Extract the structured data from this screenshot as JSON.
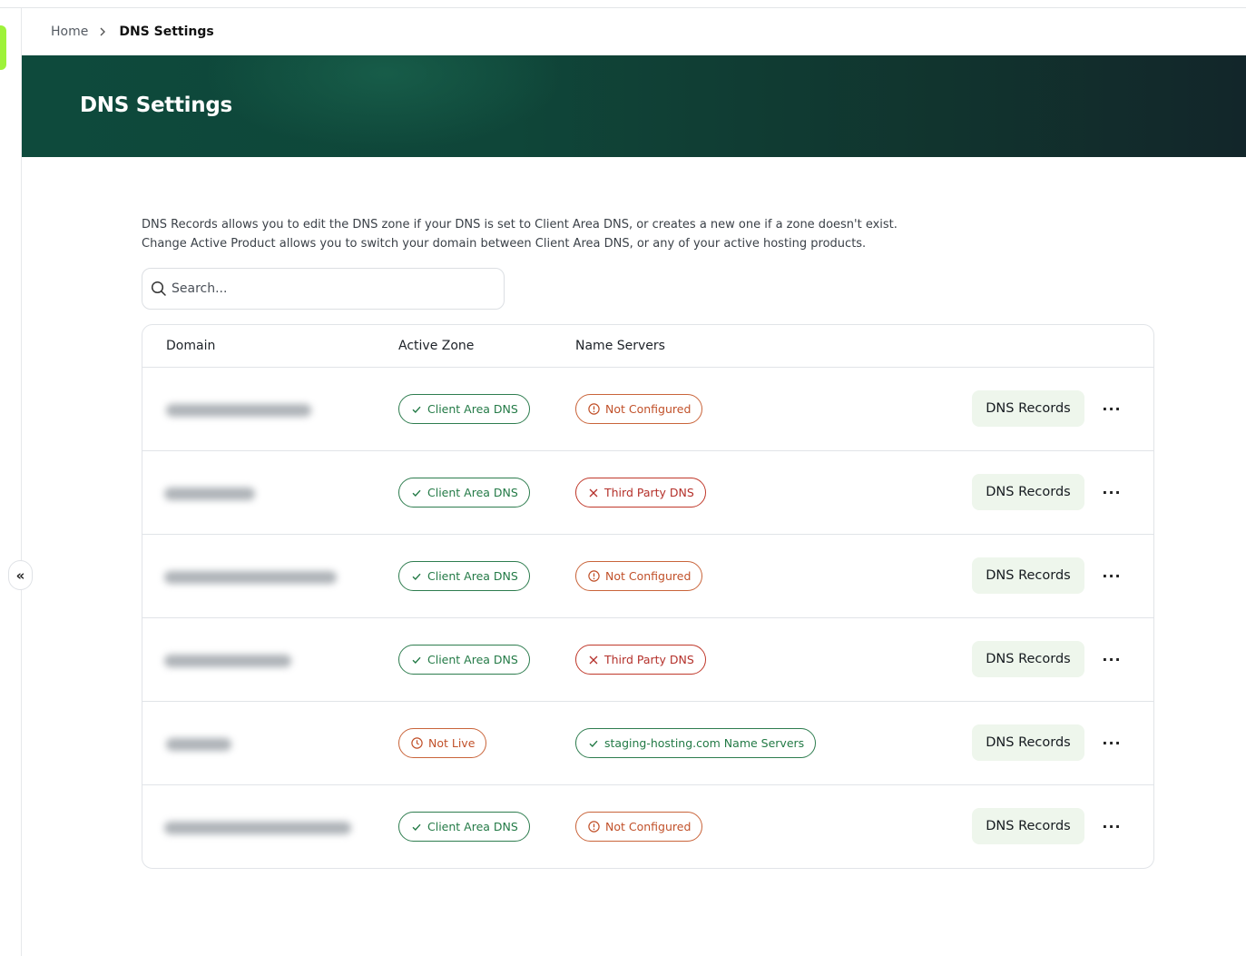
{
  "breadcrumb": {
    "home": "Home",
    "current": "DNS Settings"
  },
  "hero": {
    "title": "DNS Settings"
  },
  "description": {
    "line1": "DNS Records allows you to edit the DNS zone if your DNS is set to Client Area DNS, or creates a new one if a zone doesn't exist.",
    "line2": "Change Active Product allows you to switch your domain between Client Area DNS, or any of your active hosting products."
  },
  "search": {
    "placeholder": "Search..."
  },
  "table": {
    "columns": {
      "domain": "Domain",
      "active_zone": "Active Zone",
      "name_servers": "Name Servers"
    },
    "rows": [
      {
        "domain": "",
        "zone": {
          "label": "Client Area DNS",
          "status": "success"
        },
        "ns": {
          "label": "Not Configured",
          "status": "warning"
        },
        "action": "DNS Records",
        "more": "···"
      },
      {
        "domain": "",
        "zone": {
          "label": "Client Area DNS",
          "status": "success"
        },
        "ns": {
          "label": "Third Party DNS",
          "status": "error"
        },
        "action": "DNS Records",
        "more": "···"
      },
      {
        "domain": "",
        "zone": {
          "label": "Client Area DNS",
          "status": "success"
        },
        "ns": {
          "label": "Not Configured",
          "status": "warning"
        },
        "action": "DNS Records",
        "more": "···"
      },
      {
        "domain": "",
        "zone": {
          "label": "Client Area DNS",
          "status": "success"
        },
        "ns": {
          "label": "Third Party DNS",
          "status": "error"
        },
        "action": "DNS Records",
        "more": "···"
      },
      {
        "domain": "",
        "zone": {
          "label": "Not Live",
          "status": "pending"
        },
        "ns": {
          "label": "staging-hosting.com Name Servers",
          "status": "success"
        },
        "action": "DNS Records",
        "more": "···"
      },
      {
        "domain": "",
        "zone": {
          "label": "Client Area DNS",
          "status": "success"
        },
        "ns": {
          "label": "Not Configured",
          "status": "warning"
        },
        "action": "DNS Records",
        "more": "···"
      }
    ]
  },
  "sidebar": {
    "collapse_label": "«"
  },
  "colors": {
    "accent": "#9ef23a",
    "hero_start": "#0e4a3c",
    "hero_end": "#12262a",
    "success": "#237a46",
    "warning": "#c1512a",
    "error": "#b4302a",
    "action_bg": "#eef6ec"
  },
  "icons": {
    "search": "search-icon",
    "check": "check-icon",
    "alert": "alert-circle-icon",
    "close": "x-icon",
    "clock": "clock-icon",
    "chevron": "chevron-right-icon",
    "more": "more-horizontal-icon",
    "collapse": "chevrons-left-icon"
  }
}
